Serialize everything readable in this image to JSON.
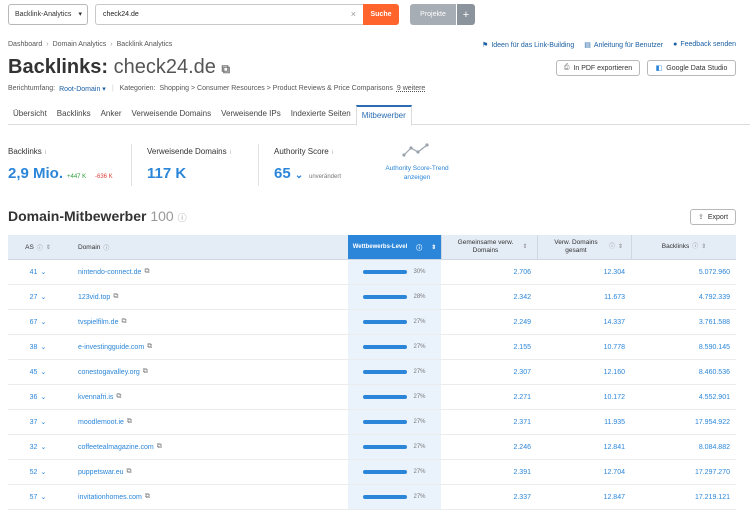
{
  "topbar": {
    "database_select": "Backlink-Analytics",
    "search_value": "check24.de",
    "search_button": "Suche",
    "projekte_button": "Projekte",
    "plus_button": "+"
  },
  "breadcrumb": [
    "Dashboard",
    "Domain Analytics",
    "Backlink Analytics"
  ],
  "top_links": [
    "Ideen für das Link-Building",
    "Anleitung für Benutzer",
    "Feedback senden"
  ],
  "title": {
    "prefix": "Backlinks:",
    "domain": "check24.de"
  },
  "buttons": {
    "pdf": "In PDF exportieren",
    "gds": "Google Data Studio",
    "export": "Export"
  },
  "scope": {
    "label": "Berichtumfang:",
    "value": "Root-Domain",
    "categories_label": "Kategorien:",
    "categories_value": "Shopping > Consumer Resources > Product Reviews & Price Comparisons",
    "more": "9 weitere"
  },
  "tabs": [
    "Übersicht",
    "Backlinks",
    "Anker",
    "Verweisende Domains",
    "Verweisende IPs",
    "Indexierte Seiten",
    "Mitbewerber"
  ],
  "active_tab": "Mitbewerber",
  "metrics": {
    "backlinks": {
      "label": "Backlinks",
      "value": "2,9 Mio.",
      "up": "+447 K",
      "down": "-636 K"
    },
    "ref_domains": {
      "label": "Verweisende Domains",
      "value": "117 K"
    },
    "authority": {
      "label": "Authority Score",
      "value": "65",
      "status": "unverändert"
    },
    "trend_link": "Authority Score-Trend anzeigen"
  },
  "section": {
    "title": "Domain-Mitbewerber",
    "count": "100"
  },
  "table": {
    "headers": {
      "as": "AS",
      "domain": "Domain",
      "level": "Wettbewerbs-Level",
      "common": "Gemeinsame verw. Domains",
      "ref": "Verw. Domains gesamt",
      "backlinks": "Backlinks"
    },
    "rows": [
      {
        "as": "41",
        "domain": "nintendo-connect.de",
        "level": 0.3,
        "level_text": "30%",
        "common": "2.706",
        "ref": "12.304",
        "backlinks": "5.072.960"
      },
      {
        "as": "27",
        "domain": "123vid.top",
        "level": 0.28,
        "level_text": "28%",
        "common": "2.342",
        "ref": "11.673",
        "backlinks": "4.792.339"
      },
      {
        "as": "67",
        "domain": "tvspielfilm.de",
        "level": 0.27,
        "level_text": "27%",
        "common": "2.249",
        "ref": "14.337",
        "backlinks": "3.761.588"
      },
      {
        "as": "38",
        "domain": "e-investingguide.com",
        "level": 0.27,
        "level_text": "27%",
        "common": "2.155",
        "ref": "10.778",
        "backlinks": "8.590.145"
      },
      {
        "as": "45",
        "domain": "conestogavalley.org",
        "level": 0.27,
        "level_text": "27%",
        "common": "2.307",
        "ref": "12.160",
        "backlinks": "8.460.536"
      },
      {
        "as": "36",
        "domain": "kvennafri.is",
        "level": 0.27,
        "level_text": "27%",
        "common": "2.271",
        "ref": "10.172",
        "backlinks": "4.552.901"
      },
      {
        "as": "37",
        "domain": "moodlemoot.ie",
        "level": 0.27,
        "level_text": "27%",
        "common": "2.371",
        "ref": "11.935",
        "backlinks": "17.954.922"
      },
      {
        "as": "32",
        "domain": "coffeetealmagazine.com",
        "level": 0.27,
        "level_text": "27%",
        "common": "2.246",
        "ref": "12.841",
        "backlinks": "8.084.882"
      },
      {
        "as": "52",
        "domain": "puppetswar.eu",
        "level": 0.27,
        "level_text": "27%",
        "common": "2.391",
        "ref": "12.704",
        "backlinks": "17.297.270"
      },
      {
        "as": "57",
        "domain": "invitationhomes.com",
        "level": 0.27,
        "level_text": "27%",
        "common": "2.337",
        "ref": "12.847",
        "backlinks": "17.219.121"
      }
    ]
  },
  "colors": {
    "accent": "#2b86d9",
    "search_button": "#ff642d",
    "positive": "#2a9d3a",
    "negative": "#e0403b"
  }
}
